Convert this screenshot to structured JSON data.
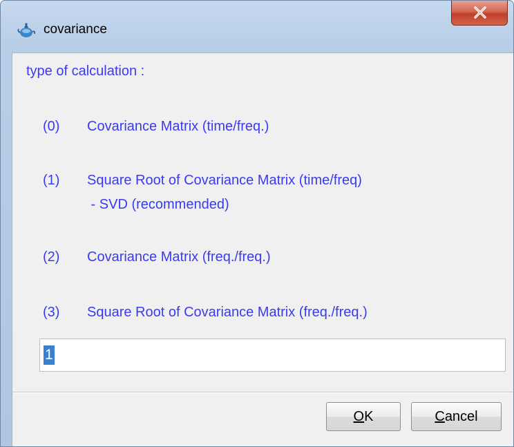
{
  "window": {
    "title": "covariance",
    "close_glyph": "x",
    "app_icon": "teapot-app-icon"
  },
  "dialog": {
    "heading": "type of calculation :",
    "options": [
      {
        "number": "(0)",
        "lines": [
          "Covariance Matrix (time/freq.)"
        ]
      },
      {
        "number": "(1)",
        "lines": [
          "Square Root of Covariance Matrix (time/freq)",
          " - SVD (recommended)"
        ]
      },
      {
        "number": "(2)",
        "lines": [
          "Covariance Matrix (freq./freq.)"
        ]
      },
      {
        "number": "(3)",
        "lines": [
          "Square Root of Covariance Matrix (freq./freq.)"
        ]
      }
    ],
    "input_value": "1"
  },
  "buttons": {
    "ok": {
      "mnemonic": "O",
      "rest": "K"
    },
    "cancel": {
      "mnemonic": "C",
      "rest": "ancel"
    }
  },
  "colors": {
    "text_accent": "#3a3af0",
    "selection": "#3a80d0",
    "close_button": "#c8503a"
  }
}
